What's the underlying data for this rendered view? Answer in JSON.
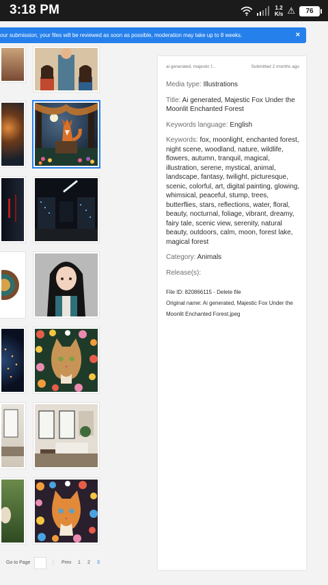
{
  "status_bar": {
    "time": "3:18 PM",
    "speed_value": "1.2",
    "speed_unit": "K/s",
    "battery": "76"
  },
  "notice": {
    "text": "our submission, your files will be reviewed as soon as possible, moderation may take up to 8 weeks.",
    "close_label": "×"
  },
  "thumbnails": [
    {
      "name": "family-cartoon"
    },
    {
      "name": "forest-lake"
    },
    {
      "name": "majestic-fox",
      "selected": true
    },
    {
      "name": "server-room-red"
    },
    {
      "name": "server-room"
    },
    {
      "name": "ornament-circle"
    },
    {
      "name": "anime-girl"
    },
    {
      "name": "glowing-globe"
    },
    {
      "name": "floral-cat"
    },
    {
      "name": "living-room-left"
    },
    {
      "name": "living-room"
    },
    {
      "name": "animal-forest"
    },
    {
      "name": "floral-cat-2"
    }
  ],
  "pagination": {
    "goto_label": "Go to Page",
    "prev_label": "Prev",
    "pages": [
      "1",
      "2",
      "3"
    ],
    "current": "3"
  },
  "details": {
    "filename_short": "ai generated, majestic f...",
    "submitted": "Submitted 2 months ago",
    "media_type_label": "Media type:",
    "media_type": "Illustrations",
    "title_label": "Title:",
    "title": "Ai generated, Majestic Fox Under the Moonlit Enchanted Forest",
    "keywords_language_label": "Keywords language:",
    "keywords_language": "English",
    "keywords_label": "Keywords:",
    "keywords": "fox, moonlight, enchanted forest, night scene, woodland, nature, wildlife, flowers, autumn, tranquil, magical, illustration, serene, mystical, animal, landscape, fantasy, twilight, picturesque, scenic, colorful, art, digital painting, glowing, whimsical, peaceful, stump, trees, butterflies, stars, reflections, water, floral, beauty, nocturnal, foliage, vibrant, dreamy, fairy tale, scenic view, serenity, natural beauty, outdoors, calm, moon, forest lake, magical forest",
    "category_label": "Category:",
    "category": "Animals",
    "release_label": "Release(s):",
    "file_id": "File ID: 820866115 - Delete file",
    "original_name": "Original name: Ai generated, Majestic Fox Under the Moonlit Enchanted Forest.jpeg"
  },
  "colors": {
    "accent": "#2680eb",
    "status_bar": "#1b1b1b"
  }
}
